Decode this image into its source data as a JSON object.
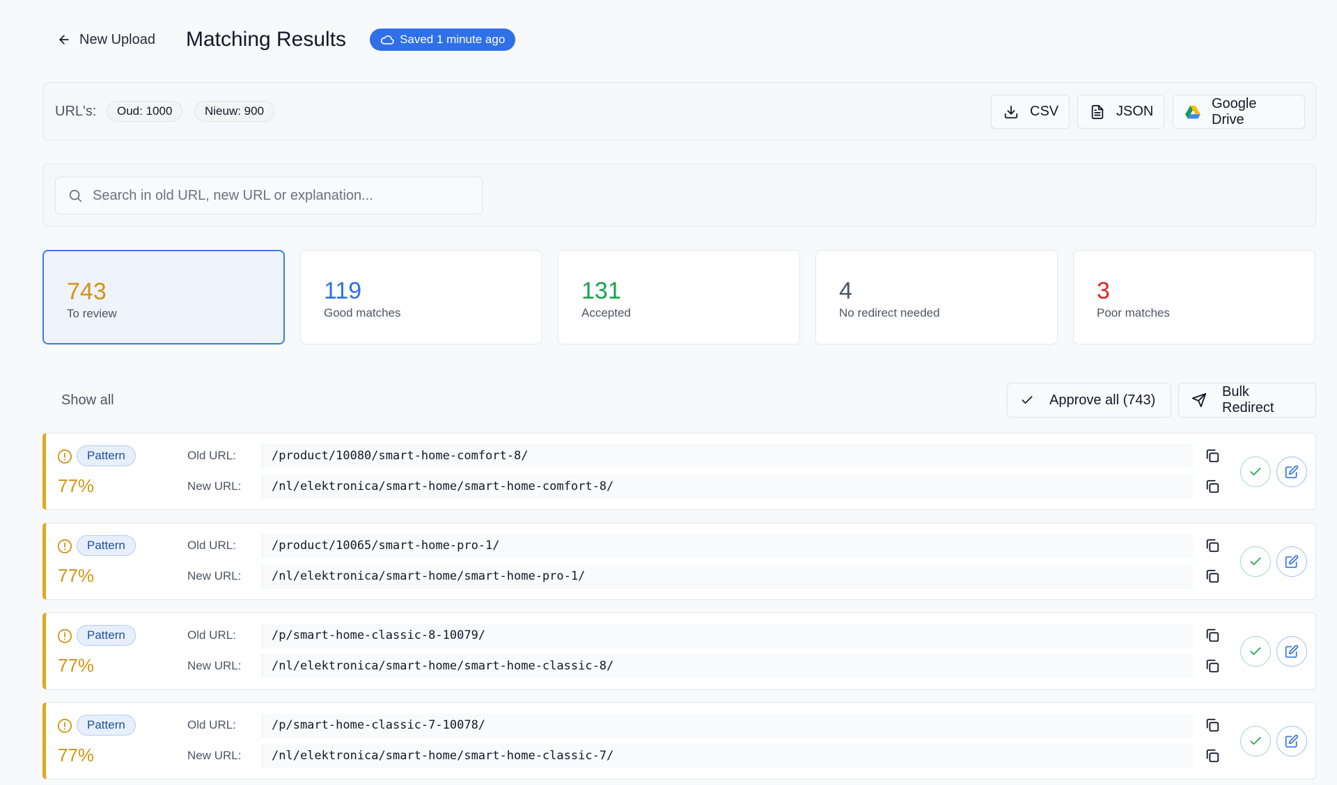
{
  "header": {
    "back_label": "New Upload",
    "title": "Matching Results",
    "saved_label": "Saved 1 minute ago"
  },
  "urls_panel": {
    "label": "URL's:",
    "old_count": "Oud: 1000",
    "new_count": "Nieuw: 900",
    "exports": {
      "csv": "CSV",
      "json": "JSON",
      "gdrive": "Google Drive"
    }
  },
  "search": {
    "placeholder": "Search in old URL, new URL or explanation..."
  },
  "stats": [
    {
      "value": "743",
      "label": "To review",
      "color": "#d49312"
    },
    {
      "value": "119",
      "label": "Good matches",
      "color": "#2f6fe8"
    },
    {
      "value": "131",
      "label": "Accepted",
      "color": "#16a34a"
    },
    {
      "value": "4",
      "label": "No redirect needed",
      "color": "#4b5563"
    },
    {
      "value": "3",
      "label": "Poor matches",
      "color": "#dc2626"
    }
  ],
  "toolbar": {
    "show_all": "Show all",
    "approve_all": "Approve all (743)",
    "bulk_redirect": "Bulk Redirect"
  },
  "row_labels": {
    "old": "Old URL:",
    "new": "New URL:"
  },
  "rows": [
    {
      "badge": "Pattern",
      "percent": "77%",
      "old_url": "/product/10080/smart-home-comfort-8/",
      "new_url": "/nl/elektronica/smart-home/smart-home-comfort-8/"
    },
    {
      "badge": "Pattern",
      "percent": "77%",
      "old_url": "/product/10065/smart-home-pro-1/",
      "new_url": "/nl/elektronica/smart-home/smart-home-pro-1/"
    },
    {
      "badge": "Pattern",
      "percent": "77%",
      "old_url": "/p/smart-home-classic-8-10079/",
      "new_url": "/nl/elektronica/smart-home/smart-home-classic-8/"
    },
    {
      "badge": "Pattern",
      "percent": "77%",
      "old_url": "/p/smart-home-classic-7-10078/",
      "new_url": "/nl/elektronica/smart-home/smart-home-classic-7/"
    }
  ],
  "colors": {
    "accent": "#2f6fe8",
    "warning": "#e0a722",
    "success": "#16a34a"
  }
}
